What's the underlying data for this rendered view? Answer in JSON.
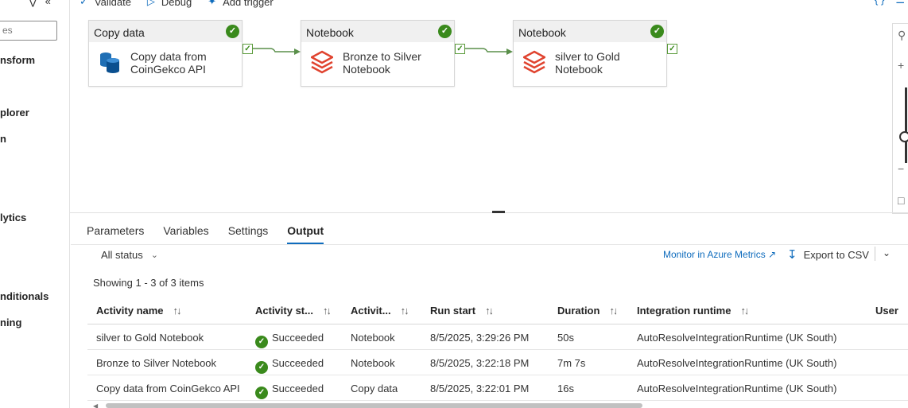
{
  "sidebar": {
    "search_placeholder": "es",
    "items": [
      "nsform",
      "plorer",
      "n",
      "lytics",
      "nditionals",
      "ning"
    ]
  },
  "toolbar": {
    "validate_label": "Validate",
    "debug_label": "Debug",
    "add_trigger_label": "Add trigger"
  },
  "pipeline": {
    "activities": [
      {
        "type": "Copy data",
        "label_line1": "Copy data from",
        "label_line2": "CoinGekco API",
        "icon": "database-copy-icon",
        "status": "success"
      },
      {
        "type": "Notebook",
        "label_line1": "Bronze to Silver",
        "label_line2": "Notebook",
        "icon": "databricks-icon",
        "status": "success"
      },
      {
        "type": "Notebook",
        "label_line1": "silver to Gold",
        "label_line2": "Notebook",
        "icon": "databricks-icon",
        "status": "success"
      }
    ]
  },
  "tabs": {
    "items": [
      "Parameters",
      "Variables",
      "Settings",
      "Output"
    ],
    "active": "Output"
  },
  "output": {
    "status_filter": "All status",
    "monitor_link": "Monitor in Azure Metrics",
    "export_label": "Export to CSV",
    "showing_text": "Showing 1 - 3 of 3 items",
    "columns": [
      "Activity name",
      "Activity st...",
      "Activit...",
      "Run start",
      "Duration",
      "Integration runtime",
      "User"
    ],
    "rows": [
      {
        "name": "silver to Gold Notebook",
        "status": "Succeeded",
        "type": "Notebook",
        "run_start": "8/5/2025, 3:29:26 PM",
        "duration": "50s",
        "runtime": "AutoResolveIntegrationRuntime (UK South)"
      },
      {
        "name": "Bronze to Silver Notebook",
        "status": "Succeeded",
        "type": "Notebook",
        "run_start": "8/5/2025, 3:22:18 PM",
        "duration": "7m 7s",
        "runtime": "AutoResolveIntegrationRuntime (UK South)"
      },
      {
        "name": "Copy data from CoinGekco API",
        "status": "Succeeded",
        "type": "Copy data",
        "run_start": "8/5/2025, 3:22:01 PM",
        "duration": "16s",
        "runtime": "AutoResolveIntegrationRuntime (UK South)"
      }
    ]
  },
  "colors": {
    "accent": "#0f6cbd",
    "success": "#3a8a1c",
    "databricks": "#e0432f"
  }
}
